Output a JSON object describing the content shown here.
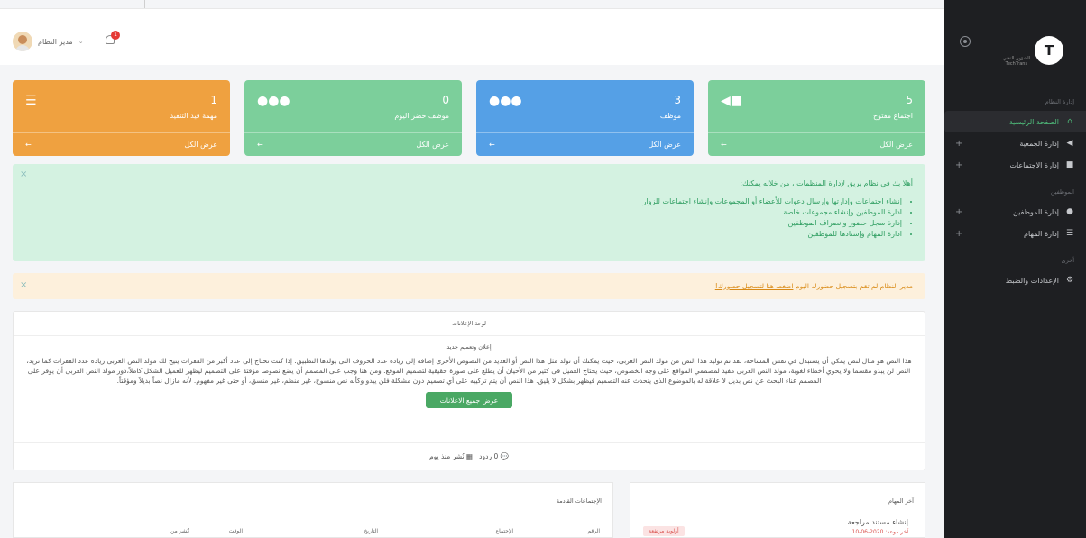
{
  "header": {
    "user_name": "مدير النظام",
    "notification_count": "1"
  },
  "sidebar": {
    "logo_glyph": "T",
    "logo_text_line1": "الشؤون التقني",
    "logo_text_line2": "TechTrans",
    "section1": "إدارة النظام",
    "section2": "الموظفين",
    "section3": "أخرى",
    "items": [
      {
        "label": "الصفحة الرئيسية",
        "icon": "home-icon"
      },
      {
        "label": "إدارة الجمعية",
        "icon": "bullhorn-icon",
        "plus": "+"
      },
      {
        "label": "إدارة الاجتماعات",
        "icon": "video-icon",
        "plus": "+"
      },
      {
        "label": "إدارة الموظفين",
        "icon": "users-icon",
        "plus": "+"
      },
      {
        "label": "إدارة المهام",
        "icon": "tasks-icon",
        "plus": "+"
      },
      {
        "label": "الإعدادات والضبط",
        "icon": "gears-icon"
      }
    ]
  },
  "cards": [
    {
      "number": "5",
      "label": "اجتماع مفتوح",
      "view_all": "عرض الكل",
      "icon": "video-icon",
      "color": "#7ccf9b"
    },
    {
      "number": "3",
      "label": "موظف",
      "view_all": "عرض الكل",
      "icon": "users-icon",
      "color": "#55a0e6"
    },
    {
      "number": "0",
      "label": "موظف حضر اليوم",
      "view_all": "عرض الكل",
      "icon": "users-icon",
      "color": "#7ccf9b"
    },
    {
      "number": "1",
      "label": "مهمة قيد التنفيذ",
      "view_all": "عرض الكل",
      "icon": "tasks-icon",
      "color": "#efa140"
    }
  ],
  "welcome": {
    "title": "أهلا بك في نظام بريق لإدارة المنظمات ، من خلاله يمكنك:",
    "items": [
      "إنشاء اجتماعات وإدارتها وإرسال دعوات للأعضاء أو المجموعات وإنشاء اجتماعات للزوار",
      "ادارة الموظفين وإنشاء مجموعات خاصة",
      "إدارة سجل حضور وانصراف الموظفين",
      "ادارة المهام وإسنادها للموظفين"
    ]
  },
  "attendance_alert": {
    "text": "مدير النظام لم تقم بتسجيل حضورك اليوم",
    "link": "اضغط هنا لتسجيل حضورك!"
  },
  "announcements": {
    "panel_title": "لوحة الإعلانات",
    "title": "إعلان وتعميم جديد",
    "body": "هذا النص هو مثال لنص يمكن أن يستبدل في نفس المساحة، لقد تم توليد هذا النص من مولد النص العربى، حيث يمكنك أن تولد مثل هذا النص أو العديد من النصوص الأخرى إضافة إلى زيادة عدد الحروف التى يولدها التطبيق. إذا كنت تحتاج إلى عدد أكبر من الفقرات يتيح لك مولد النص العربى زيادة عدد الفقرات كما تريد، النص لن يبدو مقسما ولا يحوي أخطاء لغوية، مولد النص العربى مفيد لمصممي المواقع على وجه الخصوص، حيث يحتاج العميل فى كثير من الأحيان أن يطلع على صورة حقيقية لتصميم الموقع. ومن هنا وجب على المصمم أن يضع نصوصا مؤقتة على التصميم ليظهر للعميل الشكل كاملاً،دور مولد النص العربى أن يوفر على المصمم عناء البحث عن نص بديل لا علاقة له بالموضوع الذى يتحدث عنه التصميم فيظهر بشكل لا يليق. هذا النص أن يتم تركيبه على أي تصميم دون مشكلة فلن يبدو وكأنه نص منسوخ، غير منظم، غير منسق، أو حتى غير مفهوم. لأنه مازال نصاً بديلاً ومؤقتاً.",
    "button": "عرض جميع الاعلانات",
    "replies": "0 ردود",
    "published": "نُشر منذ يوم"
  },
  "tasks": {
    "title": "آخر المهام",
    "task_name": "إنشاء مستند مراجعة",
    "due": "آخر موعد: 2020-06-10",
    "priority": "أولوية مرتفعة"
  },
  "meetings": {
    "title": "الإجتماعات القادمة",
    "columns": [
      "الرقم",
      "الإجتماع",
      "التاريخ",
      "الوقت",
      "نُشر من"
    ]
  }
}
